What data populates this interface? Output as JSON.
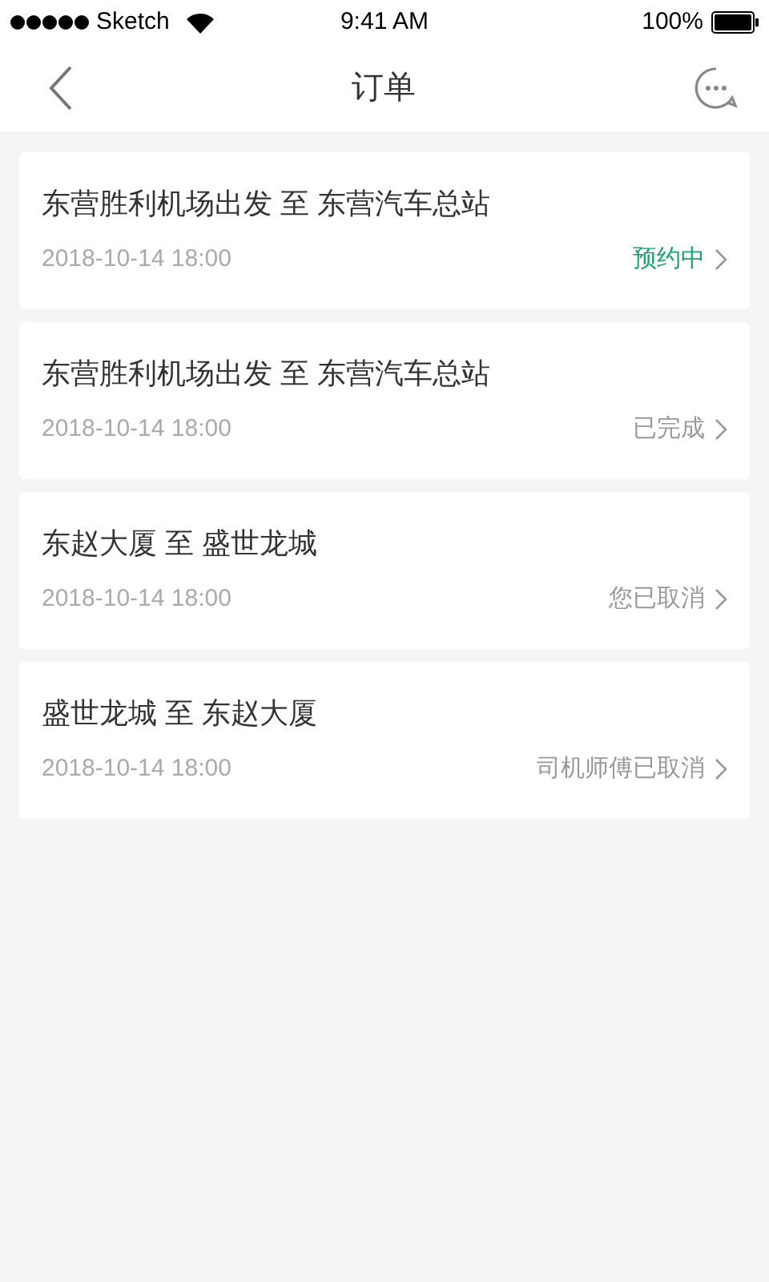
{
  "status_bar": {
    "carrier": "Sketch",
    "time": "9:41 AM",
    "battery": "100%"
  },
  "nav": {
    "title": "订单"
  },
  "orders": [
    {
      "route": "东营胜利机场出发 至 东营汽车总站",
      "time": "2018-10-14 18:00",
      "status": "预约中",
      "color": "#1aa36a"
    },
    {
      "route": "东营胜利机场出发 至 东营汽车总站",
      "time": "2018-10-14 18:00",
      "status": "已完成",
      "color": "#999999"
    },
    {
      "route": "东赵大厦 至 盛世龙城",
      "time": "2018-10-14 18:00",
      "status": "您已取消",
      "color": "#999999"
    },
    {
      "route": "盛世龙城 至 东赵大厦",
      "time": "2018-10-14 18:00",
      "status": "司机师傅已取消",
      "color": "#999999"
    }
  ]
}
